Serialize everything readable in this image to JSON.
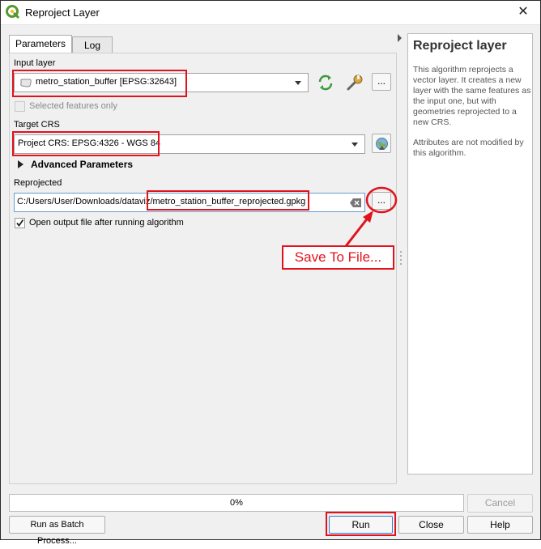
{
  "window": {
    "title": "Reproject Layer",
    "close_glyph": "✕"
  },
  "tabs": [
    {
      "label": "Parameters"
    },
    {
      "label": "Log"
    }
  ],
  "input_layer": {
    "label": "Input layer",
    "value": "metro_station_buffer [EPSG:32643]",
    "more_button": "..."
  },
  "selected_only": {
    "label": "Selected features only",
    "checked": false
  },
  "target_crs": {
    "label": "Target CRS",
    "value": "Project CRS: EPSG:4326 - WGS 84"
  },
  "advanced": {
    "label": "Advanced Parameters"
  },
  "reprojected": {
    "label": "Reprojected",
    "path_prefix": "C:/Users/User/Downloads/dataviz/",
    "path_file": "metro_station_buffer_reprojected.gpkg",
    "browse_button": "..."
  },
  "open_output": {
    "label": "Open output file after running algorithm",
    "checked": true
  },
  "annotation": {
    "text": "Save To File...",
    "color": "#e0131c"
  },
  "help": {
    "title": "Reproject layer",
    "p1": "This algorithm reprojects a vector layer. It creates a new layer with the same features as the input one, but with geometries reprojected to a new CRS.",
    "p2": "Attributes are not modified by this algorithm."
  },
  "progress": {
    "text": "0%",
    "value": 0
  },
  "buttons": {
    "cancel": "Cancel",
    "batch": "Run as Batch Process...",
    "run": "Run",
    "close": "Close",
    "help": "Help"
  }
}
